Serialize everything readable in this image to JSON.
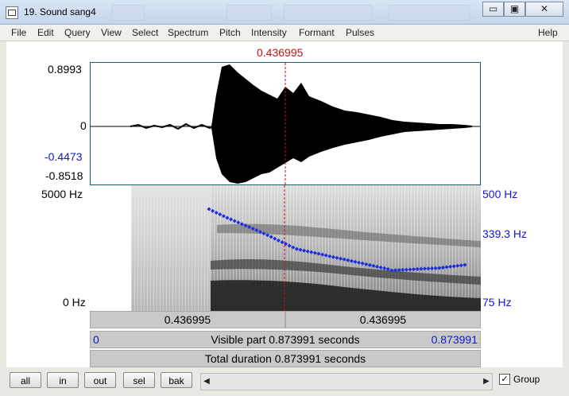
{
  "window": {
    "title": "19. Sound sang4",
    "controls": {
      "minimize": "▭",
      "maximize": "▣",
      "close": "✕"
    }
  },
  "menu": [
    "File",
    "Edit",
    "Query",
    "View",
    "Select",
    "Spectrum",
    "Pitch",
    "Intensity",
    "Formant",
    "Pulses",
    "Help"
  ],
  "cursor": {
    "time_label": "0.436995"
  },
  "waveform": {
    "max_label": "0.8993",
    "zero_label": "0",
    "cursor_value_label": "-0.4473",
    "min_label": "-0.8518"
  },
  "spectrogram": {
    "top_label": "5000 Hz",
    "bottom_label": "0 Hz"
  },
  "pitch": {
    "top_label": "500 Hz",
    "cursor_label": "339.3 Hz",
    "bottom_label": "75 Hz",
    "color": "#1a2ee0"
  },
  "selection": {
    "left_time": "0.436995",
    "right_time": "0.436995"
  },
  "visible": {
    "start": "0",
    "label": "Visible part 0.873991 seconds",
    "end": "0.873991"
  },
  "total": {
    "label": "Total duration 0.873991 seconds"
  },
  "buttons": {
    "all": "all",
    "in": "in",
    "out": "out",
    "sel": "sel",
    "bak": "bak"
  },
  "scroll": {
    "left": "◀",
    "right": "▶"
  },
  "group": {
    "label": "Group",
    "checked": true
  }
}
